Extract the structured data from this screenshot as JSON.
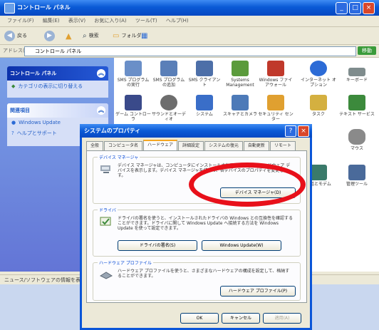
{
  "window": {
    "title": "コントロール パネル",
    "menu": [
      "ファイル(F)",
      "編集(E)",
      "表示(V)",
      "お気に入り(A)",
      "ツール(T)",
      "ヘルプ(H)"
    ],
    "toolbar": {
      "back": "戻る",
      "search": "検索",
      "folders": "フォルダ"
    },
    "address_label": "アドレス(D)",
    "address_value": "コントロール パネル",
    "go_label": "移動"
  },
  "leftpane": {
    "panel1_title": "コントロール パネル",
    "panel1_item": "カテゴリの表示に切り替える",
    "panel2_title": "関連項目",
    "panel2_items": [
      "Windows Update",
      "ヘルプとサポート"
    ]
  },
  "content": {
    "items": [
      {
        "label": "SMS プログラムの実行",
        "color": "#6a8fc8"
      },
      {
        "label": "SMS プログラムの追加",
        "color": "#5a7fb8"
      },
      {
        "label": "SMS クライアント",
        "color": "#4d6fa8"
      },
      {
        "label": "Systems Management",
        "color": "#5b9b3c"
      },
      {
        "label": "Windows ファイアウォール",
        "color": "#c0392b"
      },
      {
        "label": "インターネット オプション",
        "color": "#2c6bd6"
      },
      {
        "label": "キーボード",
        "color": "#7f8c8d"
      },
      {
        "label": "ゲーム コントローラ",
        "color": "#3a4a8a"
      },
      {
        "label": "サウンドとオーディオ",
        "color": "#6d6d6d"
      },
      {
        "label": "システム",
        "color": "#3a6ec8"
      },
      {
        "label": "スキャナとカメラ",
        "color": "#4d7ab8"
      },
      {
        "label": "セキュリティ センター",
        "color": "#e0a030"
      },
      {
        "label": "タスク",
        "color": "#d4b040"
      },
      {
        "label": "テキスト サービス",
        "color": "#3c8a3c"
      },
      {
        "label": "マウス",
        "color": "#8a8a8a"
      },
      {
        "label": "電話とモデム",
        "color": "#3a7a6a"
      },
      {
        "label": "管理ツール",
        "color": "#4a6a9a"
      }
    ],
    "status": "ニュース/ソフトウェアの情報を表示..."
  },
  "dialog": {
    "title": "システムのプロパティ",
    "tabs": [
      "全般",
      "コンピュータ名",
      "ハードウェア",
      "詳細設定",
      "システムの復元",
      "自動更新",
      "リモート"
    ],
    "active_tab": "ハードウェア",
    "device_manager": {
      "title": "デバイス マネージャ",
      "desc": "デバイス マネージャは、コンピュータにインストールされているすべてのハードウェア デバイスを表示します。デバイス マネージャを使って、各デバイスのプロパティを変更します。",
      "button": "デバイス マネージャ(D)"
    },
    "drivers": {
      "title": "ドライバ",
      "desc": "ドライバの署名を使うと、インストールされたドライバの Windows との互換性を確認することができます。ドライバに関して Windows Update へ接続する方法を Windows Update を使って設定できます。",
      "signing_button": "ドライバの署名(S)",
      "update_button": "Windows Update(W)"
    },
    "profiles": {
      "title": "ハードウェア プロファイル",
      "desc": "ハードウェア プロファイルを使うと、さまざまなハードウェアの構成を設定して、格納することができます。",
      "button": "ハードウェア プロファイル(P)"
    },
    "ok": "OK",
    "cancel": "キャンセル",
    "apply": "適用(A)"
  },
  "colors": {
    "highlight": "#e8101a",
    "titlebar": "#0a5ad6"
  }
}
